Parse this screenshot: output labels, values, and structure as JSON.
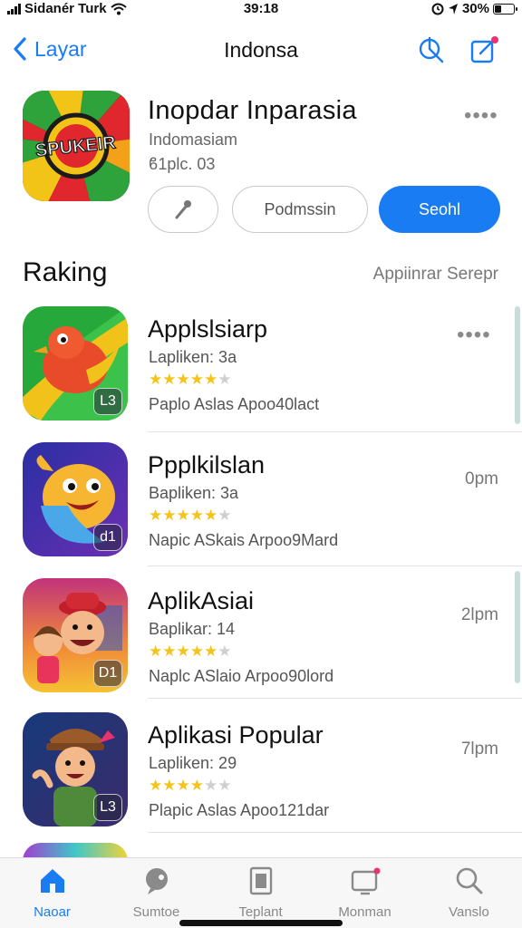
{
  "status_bar": {
    "carrier": "Sidanér Turk",
    "time": "39:18",
    "battery": "30%"
  },
  "nav": {
    "back_label": "Layar",
    "title": "Indonsa"
  },
  "featured": {
    "name": "Inopdar Inparasia",
    "subtitle": "Indomasiam",
    "meta": "ϐ1plc. 03",
    "icon_text": "SPUKEIR",
    "button_secondary": "Podmssin",
    "button_primary": "Seohl"
  },
  "section": {
    "title": "Raking",
    "link": "Appiinrar Serepr"
  },
  "apps": [
    {
      "name": "Applslsiarp",
      "sub": "Lapliken: 3a",
      "rating": 4.5,
      "desc": "Paplo Aslas  Apoo40lact",
      "time": "",
      "badge": "L3"
    },
    {
      "name": "Ppplkilslan",
      "sub": "Bapliken: 3a",
      "rating": 4.5,
      "desc": "Napic ASkais  Arpoo9Mard",
      "time": "0pm",
      "badge": "d1"
    },
    {
      "name": "AplikAsiai",
      "sub": "Baplikar: 14",
      "rating": 4.5,
      "desc": "Naplc ASlaio  Arpoo90lord",
      "time": "2lpm",
      "badge": "D1"
    },
    {
      "name": "Aplikasi Popular",
      "sub": "Lapliken: 29",
      "rating": 4,
      "desc": "Plapic Aslas  Apoo121dar",
      "time": "7lpm",
      "badge": "L3"
    }
  ],
  "tabs": [
    {
      "label": "Naoar",
      "icon": "home-icon"
    },
    {
      "label": "Sumtoe",
      "icon": "chat-person-icon"
    },
    {
      "label": "Teplant",
      "icon": "document-icon"
    },
    {
      "label": "Monman",
      "icon": "notification-screen-icon"
    },
    {
      "label": "Vanslo",
      "icon": "search-icon"
    }
  ],
  "colors": {
    "accent": "#1a7cf2",
    "star": "#f3c41b"
  }
}
